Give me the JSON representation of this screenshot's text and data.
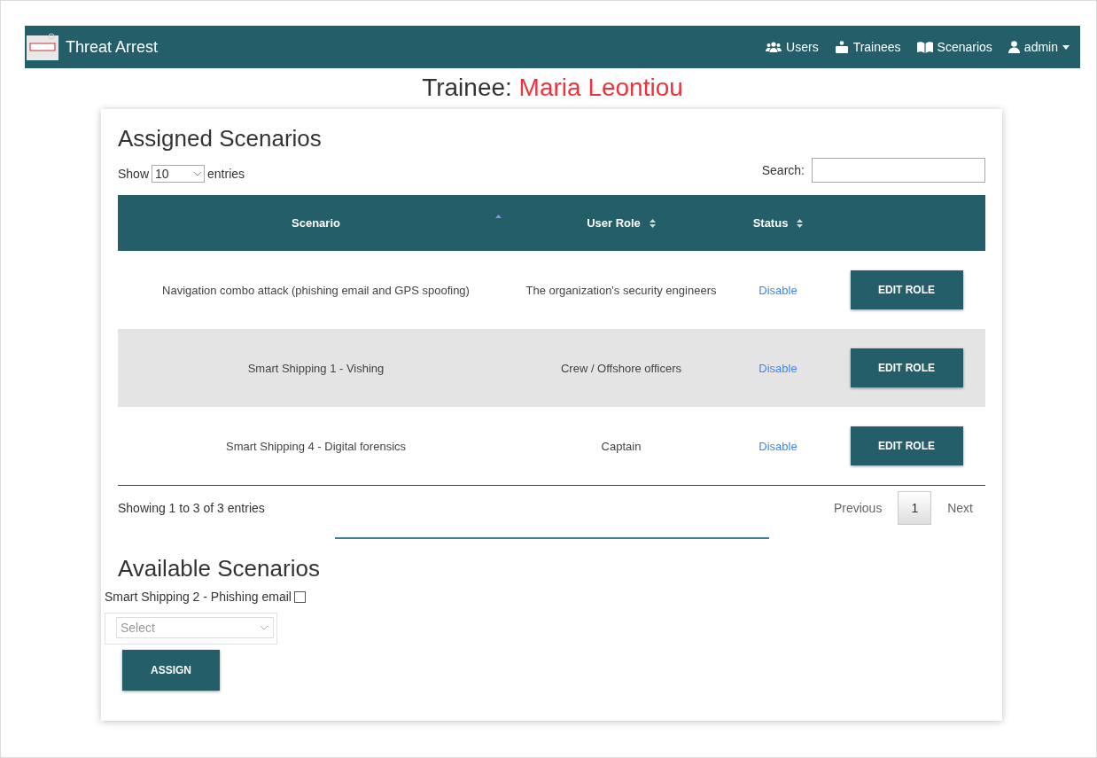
{
  "navbar": {
    "brand": "Threat Arrest",
    "links": [
      {
        "label": "Users",
        "dropdown": false
      },
      {
        "label": "Trainees",
        "dropdown": false
      },
      {
        "label": "Scenarios",
        "dropdown": false
      },
      {
        "label": "admin",
        "dropdown": true
      }
    ]
  },
  "heading": {
    "label": "Trainee:",
    "name": "Maria Leontiou"
  },
  "assigned": {
    "title": "Assigned Scenarios",
    "show_label": "Show",
    "page_size": "10",
    "entries_label": "entries",
    "search_label": "Search:",
    "columns": [
      {
        "label": "Scenario",
        "kind": "sorted"
      },
      {
        "label": "User Role",
        "kind": "sortable"
      },
      {
        "label": "Status",
        "kind": "sortable"
      }
    ],
    "rows": [
      {
        "scenario": "Navigation combo attack (phishing email and GPS spoofing)",
        "role": "The organization's security engineers",
        "status": "Disable",
        "action": "EDIT ROLE"
      },
      {
        "scenario": "Smart Shipping 1 - Vishing",
        "role": "Crew / Offshore officers",
        "status": "Disable",
        "action": "EDIT ROLE"
      },
      {
        "scenario": "Smart Shipping 4 - Digital forensics",
        "role": "Captain",
        "status": "Disable",
        "action": "EDIT ROLE"
      }
    ],
    "info": "Showing 1 to 3 of 3 entries",
    "previous": "Previous",
    "pages": [
      {
        "label": "1",
        "selected": true
      }
    ],
    "next": "Next"
  },
  "available": {
    "title": "Available Scenarios",
    "items": [
      {
        "label": "Smart Shipping 2 - Phishing email",
        "checked": false
      }
    ],
    "select_placeholder": "Select",
    "button": "ASSIGN"
  }
}
